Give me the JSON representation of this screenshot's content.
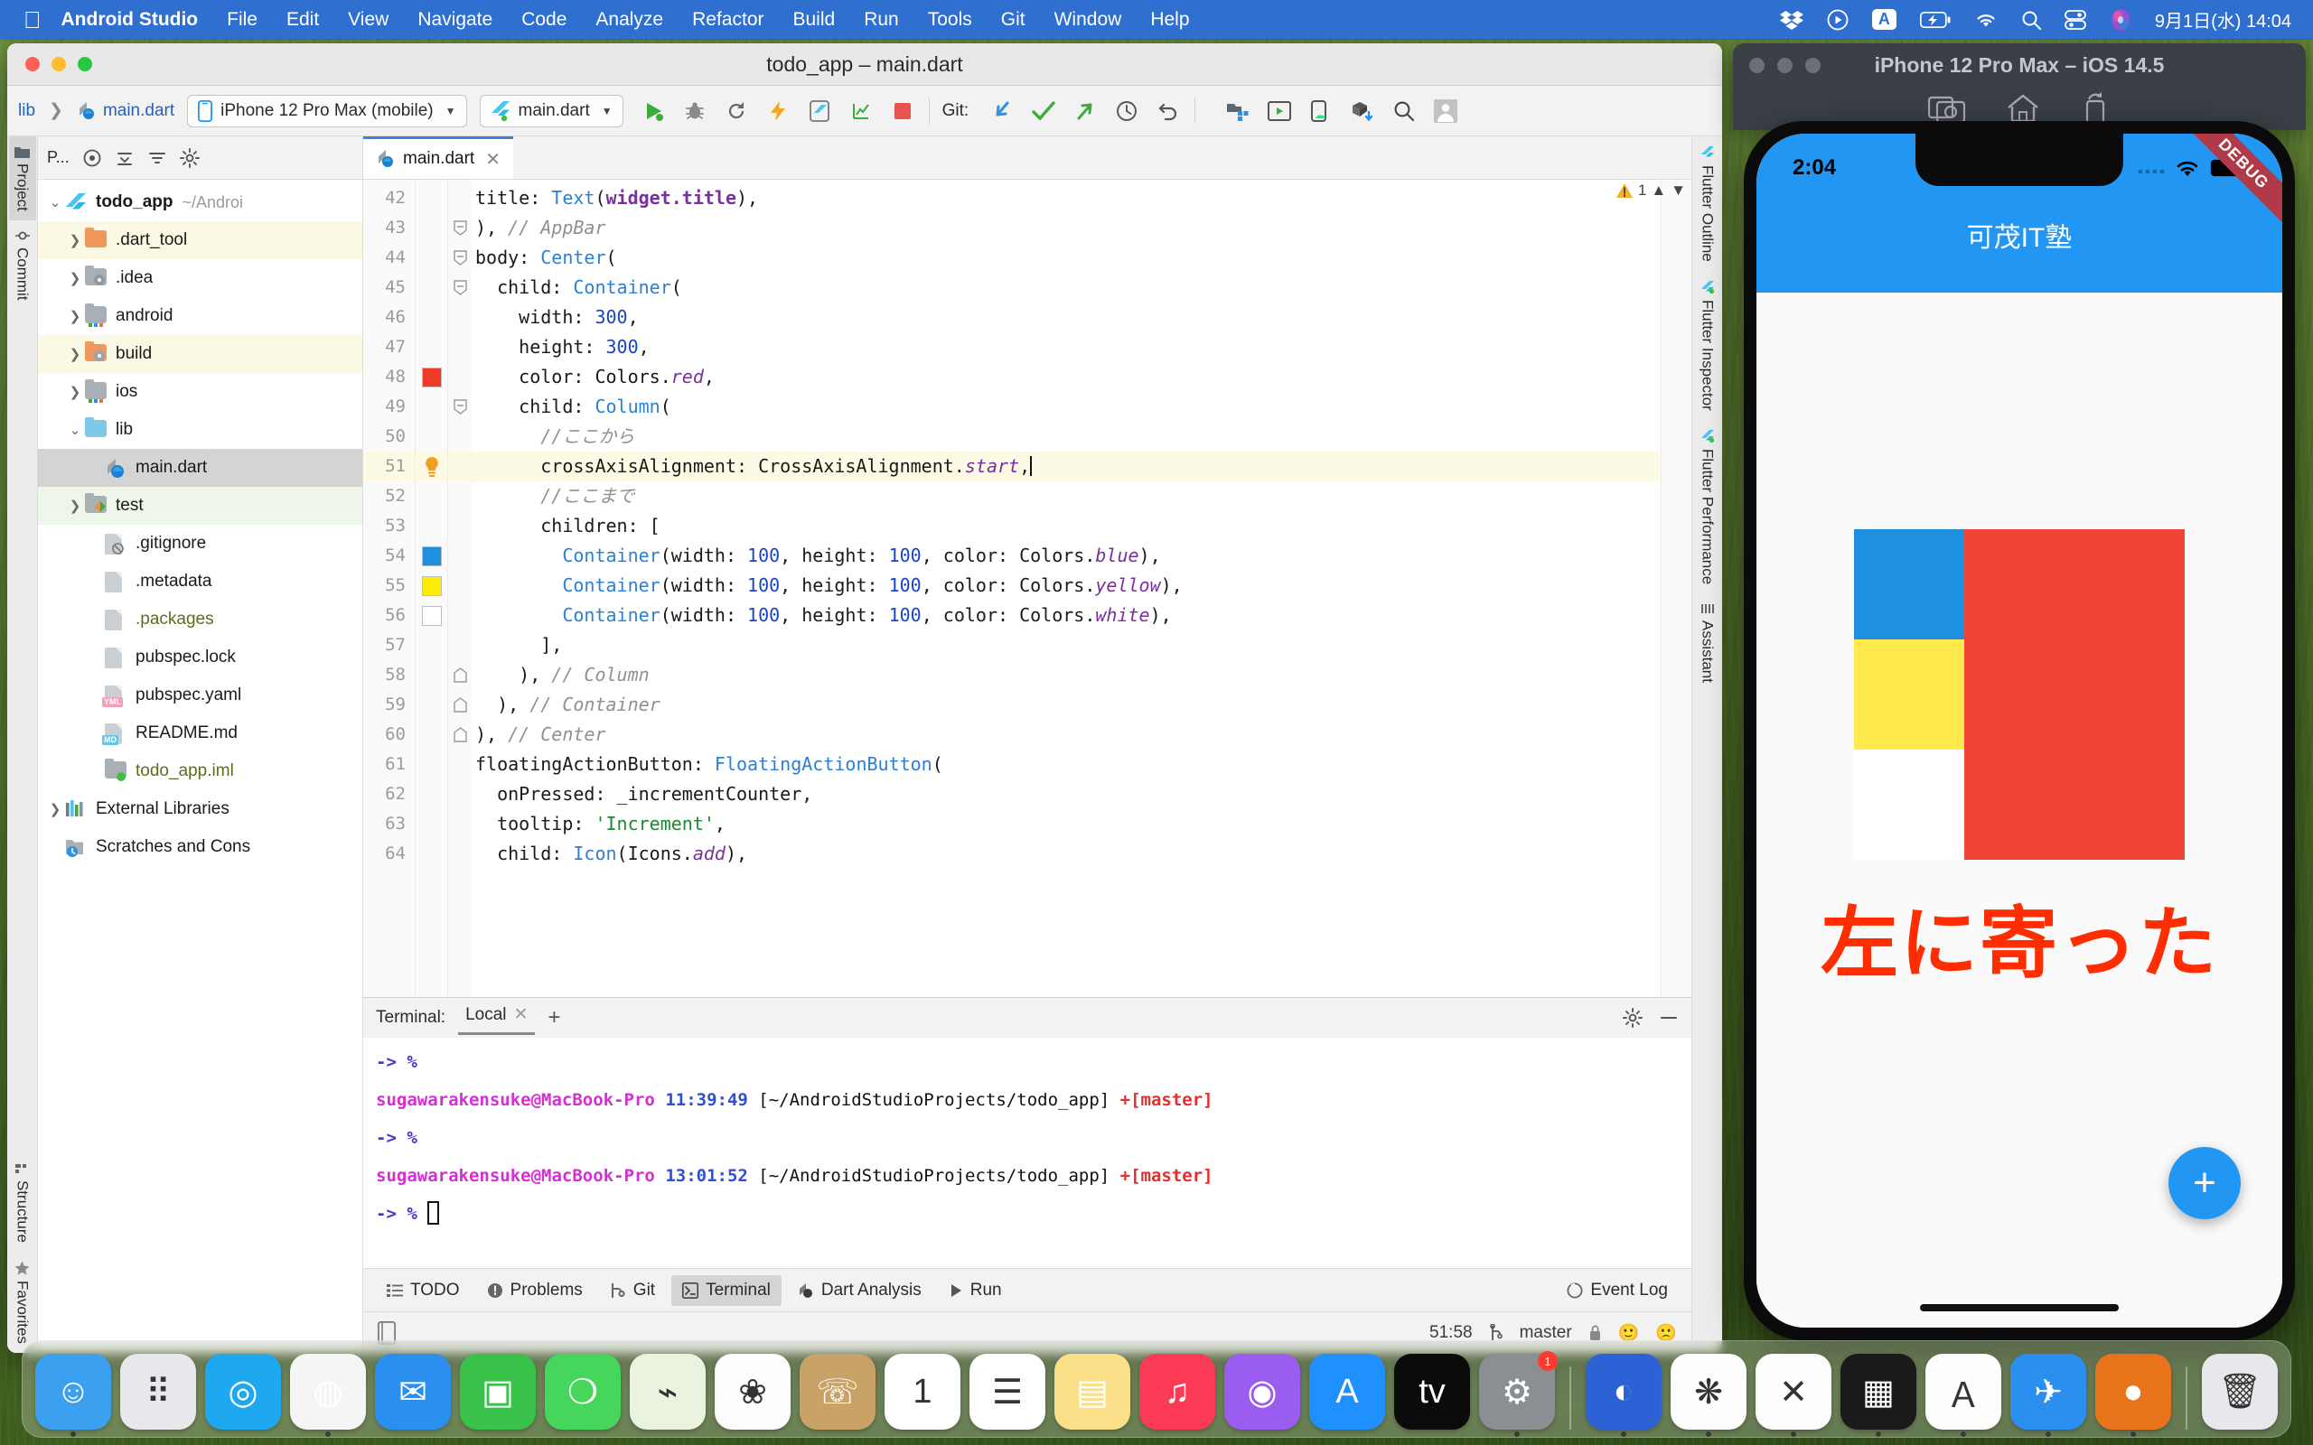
{
  "menubar": {
    "apple_icon": "apple-icon",
    "items": [
      {
        "label": "Android Studio",
        "bold": true
      },
      {
        "label": "File",
        "bold": false
      },
      {
        "label": "Edit",
        "bold": false
      },
      {
        "label": "View",
        "bold": false
      },
      {
        "label": "Navigate",
        "bold": false
      },
      {
        "label": "Code",
        "bold": false
      },
      {
        "label": "Analyze",
        "bold": false
      },
      {
        "label": "Refactor",
        "bold": false
      },
      {
        "label": "Build",
        "bold": false
      },
      {
        "label": "Run",
        "bold": false
      },
      {
        "label": "Tools",
        "bold": false
      },
      {
        "label": "Git",
        "bold": false
      },
      {
        "label": "Window",
        "bold": false
      },
      {
        "label": "Help",
        "bold": false
      }
    ],
    "status_icons": [
      "dropbox-icon",
      "screen-record-icon",
      "input-source-a-icon",
      "battery-charging-icon",
      "wifi-icon",
      "search-icon",
      "control-center-icon",
      "siri-icon"
    ],
    "clock": "9月1日(水)  14:04",
    "bar_color": "#2f6fd0"
  },
  "ide": {
    "window_title": "todo_app – main.dart",
    "breadcrumb": {
      "root": "lib",
      "file": "main.dart"
    },
    "device_selector": {
      "label": "iPhone 12 Pro Max (mobile)",
      "icon": "phone-icon"
    },
    "run_config": {
      "label": "main.dart",
      "icon": "flutter-icon"
    },
    "toolbar_icons": [
      "run-icon",
      "debug-icon",
      "hot-reload-icon",
      "hot-restart-icon",
      "open-devtools-icon",
      "profile-icon",
      "stop-icon"
    ],
    "git_label": "Git:",
    "git_icons": [
      "update-project-icon",
      "commit-icon",
      "push-icon",
      "history-icon",
      "rollback-icon"
    ],
    "right_icons": [
      "project-structure-icon",
      "avd-manager-icon",
      "sdk-manager-icon",
      "gradle-sync-icon",
      "search-everywhere-icon",
      "account-icon"
    ],
    "left_rail": [
      {
        "label": "Project",
        "icon": "folder-icon",
        "active": true
      },
      {
        "label": "Commit",
        "icon": "commit-icon",
        "active": false
      },
      {
        "label": "Structure",
        "icon": "structure-icon",
        "active": false
      },
      {
        "label": "Favorites",
        "icon": "star-icon",
        "active": false
      }
    ],
    "right_rail": [
      {
        "label": "Flutter Outline",
        "icon": "flutter-icon"
      },
      {
        "label": "Flutter Inspector",
        "icon": "flutter-icon"
      },
      {
        "label": "Flutter Performance",
        "icon": "flutter-icon"
      },
      {
        "label": "Assistant",
        "icon": "assistant-icon"
      }
    ],
    "project_panel": {
      "header": "P...",
      "header_icons": [
        "target-icon",
        "collapse-down-icon",
        "collapse-all-icon",
        "settings-icon"
      ],
      "tree": [
        {
          "label": "todo_app",
          "path": "~/Androi",
          "arrow": "down",
          "icon": "flutter",
          "indent": 0,
          "bold": true,
          "hl": ""
        },
        {
          "label": ".dart_tool",
          "path": "",
          "arrow": "right",
          "icon": "folder-orange",
          "indent": 1,
          "bold": false,
          "hl": "hl-yellow"
        },
        {
          "label": ".idea",
          "path": "",
          "arrow": "right",
          "icon": "folder-gray-mod",
          "indent": 1,
          "bold": false,
          "hl": ""
        },
        {
          "label": "android",
          "path": "",
          "arrow": "right",
          "icon": "folder-gray-android",
          "indent": 1,
          "bold": false,
          "hl": ""
        },
        {
          "label": "build",
          "path": "",
          "arrow": "right",
          "icon": "folder-orange-mod",
          "indent": 1,
          "bold": false,
          "hl": "hl-yellow"
        },
        {
          "label": "ios",
          "path": "",
          "arrow": "right",
          "icon": "folder-gray-android",
          "indent": 1,
          "bold": false,
          "hl": ""
        },
        {
          "label": "lib",
          "path": "",
          "arrow": "down",
          "icon": "folder-blue",
          "indent": 1,
          "bold": false,
          "hl": ""
        },
        {
          "label": "main.dart",
          "path": "",
          "arrow": "",
          "icon": "dart",
          "indent": 2,
          "bold": false,
          "hl": "hl-gray"
        },
        {
          "label": "test",
          "path": "",
          "arrow": "right",
          "icon": "folder-gray-test",
          "indent": 1,
          "bold": false,
          "hl": "hl-green"
        },
        {
          "label": ".gitignore",
          "path": "",
          "arrow": "",
          "icon": "file-ignore",
          "indent": 2,
          "bold": false,
          "hl": ""
        },
        {
          "label": ".metadata",
          "path": "",
          "arrow": "",
          "icon": "file",
          "indent": 2,
          "bold": false,
          "hl": ""
        },
        {
          "label": ".packages",
          "path": "",
          "arrow": "",
          "icon": "file",
          "indent": 2,
          "bold": false,
          "hl": ""
        },
        {
          "label": "pubspec.lock",
          "path": "",
          "arrow": "",
          "icon": "file",
          "indent": 2,
          "bold": false,
          "hl": ""
        },
        {
          "label": "pubspec.yaml",
          "path": "",
          "arrow": "",
          "icon": "file-yml",
          "indent": 2,
          "bold": false,
          "hl": ""
        },
        {
          "label": "README.md",
          "path": "",
          "arrow": "",
          "icon": "file-md",
          "indent": 2,
          "bold": false,
          "hl": ""
        },
        {
          "label": "todo_app.iml",
          "path": "",
          "arrow": "",
          "icon": "file-iml",
          "indent": 2,
          "bold": false,
          "hl": ""
        },
        {
          "label": "External Libraries",
          "path": "",
          "arrow": "right",
          "icon": "libraries",
          "indent": 0,
          "bold": false,
          "hl": ""
        },
        {
          "label": "Scratches and Cons",
          "path": "",
          "arrow": "",
          "icon": "scratches",
          "indent": 0,
          "bold": false,
          "hl": ""
        }
      ]
    },
    "editor": {
      "tab": {
        "label": "main.dart",
        "icon": "dart-icon",
        "close": "✕"
      },
      "warning_count": "1",
      "warning_icon": "warning-triangle-icon",
      "first_line_number": 42,
      "lines": [
        {
          "n": 42,
          "html": "<span class=\"kw-com\"></span>title: <span class=\"kw-type\">Text</span>(<span class=\"kw-field\">widget.title</span>),",
          "indent": 0,
          "hl": false,
          "mark": "",
          "fold": ""
        },
        {
          "n": 43,
          "html": "), <span class=\"kw-com\">// AppBar</span>",
          "indent": 0,
          "hl": false,
          "mark": "",
          "fold": "minus"
        },
        {
          "n": 44,
          "html": "body: <span class=\"kw-type\">Center</span>(",
          "indent": 0,
          "hl": false,
          "mark": "",
          "fold": "minus"
        },
        {
          "n": 45,
          "html": "  child: <span class=\"kw-type\">Container</span>(",
          "indent": 0,
          "hl": false,
          "mark": "",
          "fold": "minus"
        },
        {
          "n": 46,
          "html": "    width: <span class=\"kw-num\">300</span>,",
          "indent": 0,
          "hl": false,
          "mark": "",
          "fold": ""
        },
        {
          "n": 47,
          "html": "    height: <span class=\"kw-num\">300</span>,",
          "indent": 0,
          "hl": false,
          "mark": "",
          "fold": ""
        },
        {
          "n": 48,
          "html": "    color: Colors.<span class=\"kw-prop\">red</span>,",
          "indent": 0,
          "hl": false,
          "mark": "#f03a28",
          "fold": ""
        },
        {
          "n": 49,
          "html": "    child: <span class=\"kw-type\">Column</span>(",
          "indent": 0,
          "hl": false,
          "mark": "",
          "fold": "minus"
        },
        {
          "n": 50,
          "html": "      <span class=\"kw-com\">//ここから</span>",
          "indent": 0,
          "hl": false,
          "mark": "",
          "fold": ""
        },
        {
          "n": 51,
          "html": "      crossAxisAlignment: CrossAxisAlignment.<span class=\"kw-prop\">start</span>,<span class=\"caretbar\"></span>",
          "indent": 0,
          "hl": true,
          "mark": "bulb",
          "fold": ""
        },
        {
          "n": 52,
          "html": "      <span class=\"kw-com\">//ここまで</span>",
          "indent": 0,
          "hl": false,
          "mark": "",
          "fold": ""
        },
        {
          "n": 53,
          "html": "      children: [",
          "indent": 0,
          "hl": false,
          "mark": "",
          "fold": ""
        },
        {
          "n": 54,
          "html": "        <span class=\"kw-type\">Container</span>(width: <span class=\"kw-num\">100</span>, height: <span class=\"kw-num\">100</span>, color: Colors.<span class=\"kw-prop\">blue</span>),",
          "indent": 0,
          "hl": false,
          "mark": "#1f8fe0",
          "fold": ""
        },
        {
          "n": 55,
          "html": "        <span class=\"kw-type\">Container</span>(width: <span class=\"kw-num\">100</span>, height: <span class=\"kw-num\">100</span>, color: Colors.<span class=\"kw-prop\">yellow</span>),",
          "indent": 0,
          "hl": false,
          "mark": "#ffeb0a",
          "fold": ""
        },
        {
          "n": 56,
          "html": "        <span class=\"kw-type\">Container</span>(width: <span class=\"kw-num\">100</span>, height: <span class=\"kw-num\">100</span>, color: Colors.<span class=\"kw-prop\">white</span>),",
          "indent": 0,
          "hl": false,
          "mark": "#ffffff",
          "fold": ""
        },
        {
          "n": 57,
          "html": "      ],",
          "indent": 0,
          "hl": false,
          "mark": "",
          "fold": ""
        },
        {
          "n": 58,
          "html": "    ), <span class=\"kw-com\">// Column</span>",
          "indent": 0,
          "hl": false,
          "mark": "",
          "fold": "up"
        },
        {
          "n": 59,
          "html": "  ), <span class=\"kw-com\">// Container</span>",
          "indent": 0,
          "hl": false,
          "mark": "",
          "fold": "up"
        },
        {
          "n": 60,
          "html": "), <span class=\"kw-com\">// Center</span>",
          "indent": 0,
          "hl": false,
          "mark": "",
          "fold": "up"
        },
        {
          "n": 61,
          "html": "floatingActionButton: <span class=\"kw-type\">FloatingActionButton</span>(",
          "indent": 0,
          "hl": false,
          "mark": "",
          "fold": ""
        },
        {
          "n": 62,
          "html": "  onPressed: _incrementCounter,",
          "indent": 0,
          "hl": false,
          "mark": "",
          "fold": ""
        },
        {
          "n": 63,
          "html": "  tooltip: <span class=\"kw-str\">'Increment'</span>,",
          "indent": 0,
          "hl": false,
          "mark": "",
          "fold": ""
        },
        {
          "n": 64,
          "html": "  child: <span class=\"kw-type\">Icon</span>(Icons.<span class=\"kw-prop\">add</span>),",
          "indent": 0,
          "hl": false,
          "mark": "",
          "fold": ""
        }
      ]
    },
    "terminal": {
      "label": "Terminal:",
      "tab": "Local",
      "close": "✕",
      "add": "+",
      "settings_icon": "gear-icon",
      "minimize_icon": "minimize-icon",
      "lines": [
        {
          "type": "prompt",
          "prompt": "-> %",
          "user": "",
          "time": "",
          "path": "",
          "branch": "",
          "cursor": false
        },
        {
          "type": "info",
          "prompt": "",
          "user": "sugawarakensuke@MacBook-Pro",
          "time": "11:39:49",
          "path": "[~/AndroidStudioProjects/todo_app]",
          "branch": "+[master]",
          "cursor": false
        },
        {
          "type": "prompt",
          "prompt": "-> %",
          "user": "",
          "time": "",
          "path": "",
          "branch": "",
          "cursor": false
        },
        {
          "type": "info",
          "prompt": "",
          "user": "sugawarakensuke@MacBook-Pro",
          "time": "13:01:52",
          "path": "[~/AndroidStudioProjects/todo_app]",
          "branch": "+[master]",
          "cursor": false
        },
        {
          "type": "prompt",
          "prompt": "-> %",
          "user": "",
          "time": "",
          "path": "",
          "branch": "",
          "cursor": true
        }
      ]
    },
    "tool_strip": {
      "items": [
        {
          "label": "TODO",
          "icon": "todo-icon",
          "active": false
        },
        {
          "label": "Problems",
          "icon": "problems-icon",
          "active": false
        },
        {
          "label": "Git",
          "icon": "git-icon",
          "active": false
        },
        {
          "label": "Terminal",
          "icon": "terminal-icon",
          "active": true
        },
        {
          "label": "Dart Analysis",
          "icon": "dart-icon",
          "active": false
        },
        {
          "label": "Run",
          "icon": "run-icon",
          "active": false
        }
      ],
      "event_log": {
        "label": "Event Log",
        "icon": "event-log-icon"
      }
    },
    "status_bar": {
      "left_icon": "preview-icon",
      "caret_position": "51:58",
      "branch": "master",
      "branch_icon": "branch-icon",
      "lock_icon": "lock-icon",
      "faces": [
        "🙂",
        "🙁"
      ]
    }
  },
  "simulator": {
    "title": "iPhone 12 Pro Max – iOS 14.5",
    "toolbar_icons": [
      "screenshot-icon",
      "home-icon",
      "rotate-icon"
    ],
    "screen": {
      "status_time": "2:04",
      "status_icons": [
        "cellular-icon",
        "wifi-icon",
        "battery-icon"
      ],
      "debug_ribbon": "DEBUG",
      "app_title": "可茂IT塾",
      "appbar_color": "#2196f3",
      "container": {
        "color": "#f04438",
        "children": [
          {
            "color": "#1f8fe0",
            "name": "blue-box"
          },
          {
            "color": "#ffe94d",
            "name": "yellow-box"
          },
          {
            "color": "#ffffff",
            "name": "white-box"
          }
        ]
      },
      "caption": "左に寄った",
      "caption_color": "#ff2d00",
      "fab_label": "+"
    }
  },
  "dock": {
    "apps": [
      {
        "name": "finder",
        "bg": "#3aa0ef",
        "glyph": "☺",
        "dot": true
      },
      {
        "name": "launchpad",
        "bg": "#e8e8ec",
        "glyph": "⠿",
        "dot": false
      },
      {
        "name": "safari",
        "bg": "#1ea8f0",
        "glyph": "◎",
        "dot": false
      },
      {
        "name": "chrome",
        "bg": "#f5f5f5",
        "glyph": "◍",
        "dot": true
      },
      {
        "name": "mail",
        "bg": "#2b8ff0",
        "glyph": "✉",
        "dot": false
      },
      {
        "name": "facetime",
        "bg": "#39c24a",
        "glyph": "▣",
        "dot": false
      },
      {
        "name": "messages",
        "bg": "#45d65b",
        "glyph": "❍",
        "dot": false
      },
      {
        "name": "maps",
        "bg": "#e9f3e0",
        "glyph": "⌁",
        "dot": false
      },
      {
        "name": "photos",
        "bg": "#fdfdfd",
        "glyph": "❀",
        "dot": false
      },
      {
        "name": "contacts",
        "bg": "#c9a268",
        "glyph": "☏",
        "dot": false
      },
      {
        "name": "calendar",
        "bg": "#ffffff",
        "glyph": "1",
        "dot": false
      },
      {
        "name": "reminders",
        "bg": "#ffffff",
        "glyph": "☰",
        "dot": false
      },
      {
        "name": "notes",
        "bg": "#fbe089",
        "glyph": "▤",
        "dot": false
      },
      {
        "name": "music",
        "bg": "#fb3b56",
        "glyph": "♫",
        "dot": false
      },
      {
        "name": "podcasts",
        "bg": "#9b5cf0",
        "glyph": "◉",
        "dot": false
      },
      {
        "name": "app-store",
        "bg": "#1e90ff",
        "glyph": "A",
        "dot": false
      },
      {
        "name": "apple-tv",
        "bg": "#0b0b0b",
        "glyph": "tv",
        "dot": false
      },
      {
        "name": "system-preferences",
        "bg": "#8b8e92",
        "glyph": "⚙",
        "dot": true,
        "badge": "1"
      },
      {
        "name": "sep1",
        "bg": "",
        "glyph": "",
        "dot": false
      },
      {
        "name": "postman",
        "bg": "#2b63d6",
        "glyph": "◐",
        "dot": true
      },
      {
        "name": "slack",
        "bg": "#fdfdfd",
        "glyph": "❋",
        "dot": true
      },
      {
        "name": "vscode",
        "bg": "#fdfdfd",
        "glyph": "✕",
        "dot": true
      },
      {
        "name": "simulator",
        "bg": "#1a1a1a",
        "glyph": "▦",
        "dot": true
      },
      {
        "name": "android-studio",
        "bg": "#fdfdfd",
        "glyph": "Ａ",
        "dot": true
      },
      {
        "name": "xcode",
        "bg": "#2b8ff0",
        "glyph": "✈",
        "dot": true
      },
      {
        "name": "zoom",
        "bg": "#e8731a",
        "glyph": "●",
        "dot": true
      },
      {
        "name": "sep2",
        "bg": "",
        "glyph": "",
        "dot": false
      },
      {
        "name": "trash",
        "bg": "#e8e8ec",
        "glyph": "🗑",
        "dot": false
      }
    ]
  }
}
